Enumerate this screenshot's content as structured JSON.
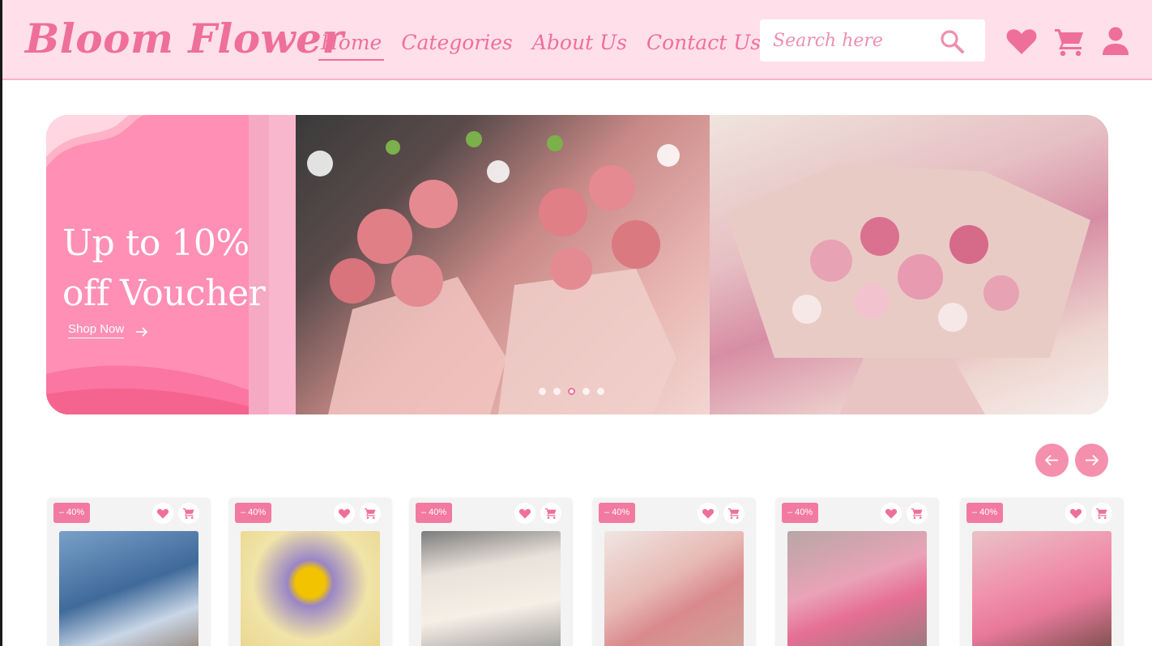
{
  "header": {
    "logo": "Bloom Flower",
    "nav": [
      {
        "label": "Home",
        "active": true
      },
      {
        "label": "Categories",
        "active": false
      },
      {
        "label": "About Us",
        "active": false
      },
      {
        "label": "Contact Us",
        "active": false
      }
    ],
    "search_placeholder": "Search here",
    "icons": [
      "search-icon",
      "heart-icon",
      "cart-icon",
      "user-icon"
    ]
  },
  "banner": {
    "promo_line1": "Up to 10%",
    "promo_line2": "off Voucher",
    "cta": "Shop Now",
    "slide_count": 5,
    "active_slide": 3
  },
  "products": [
    {
      "discount": "– 40%"
    },
    {
      "discount": "– 40%"
    },
    {
      "discount": "– 40%"
    },
    {
      "discount": "– 40%"
    },
    {
      "discount": "– 40%"
    },
    {
      "discount": "– 40%"
    }
  ],
  "colors": {
    "brand_pink": "#ef6f9b",
    "header_bg": "#ffe0ea",
    "badge": "#f27aa0",
    "promo_bg": "#ff8fb4"
  }
}
